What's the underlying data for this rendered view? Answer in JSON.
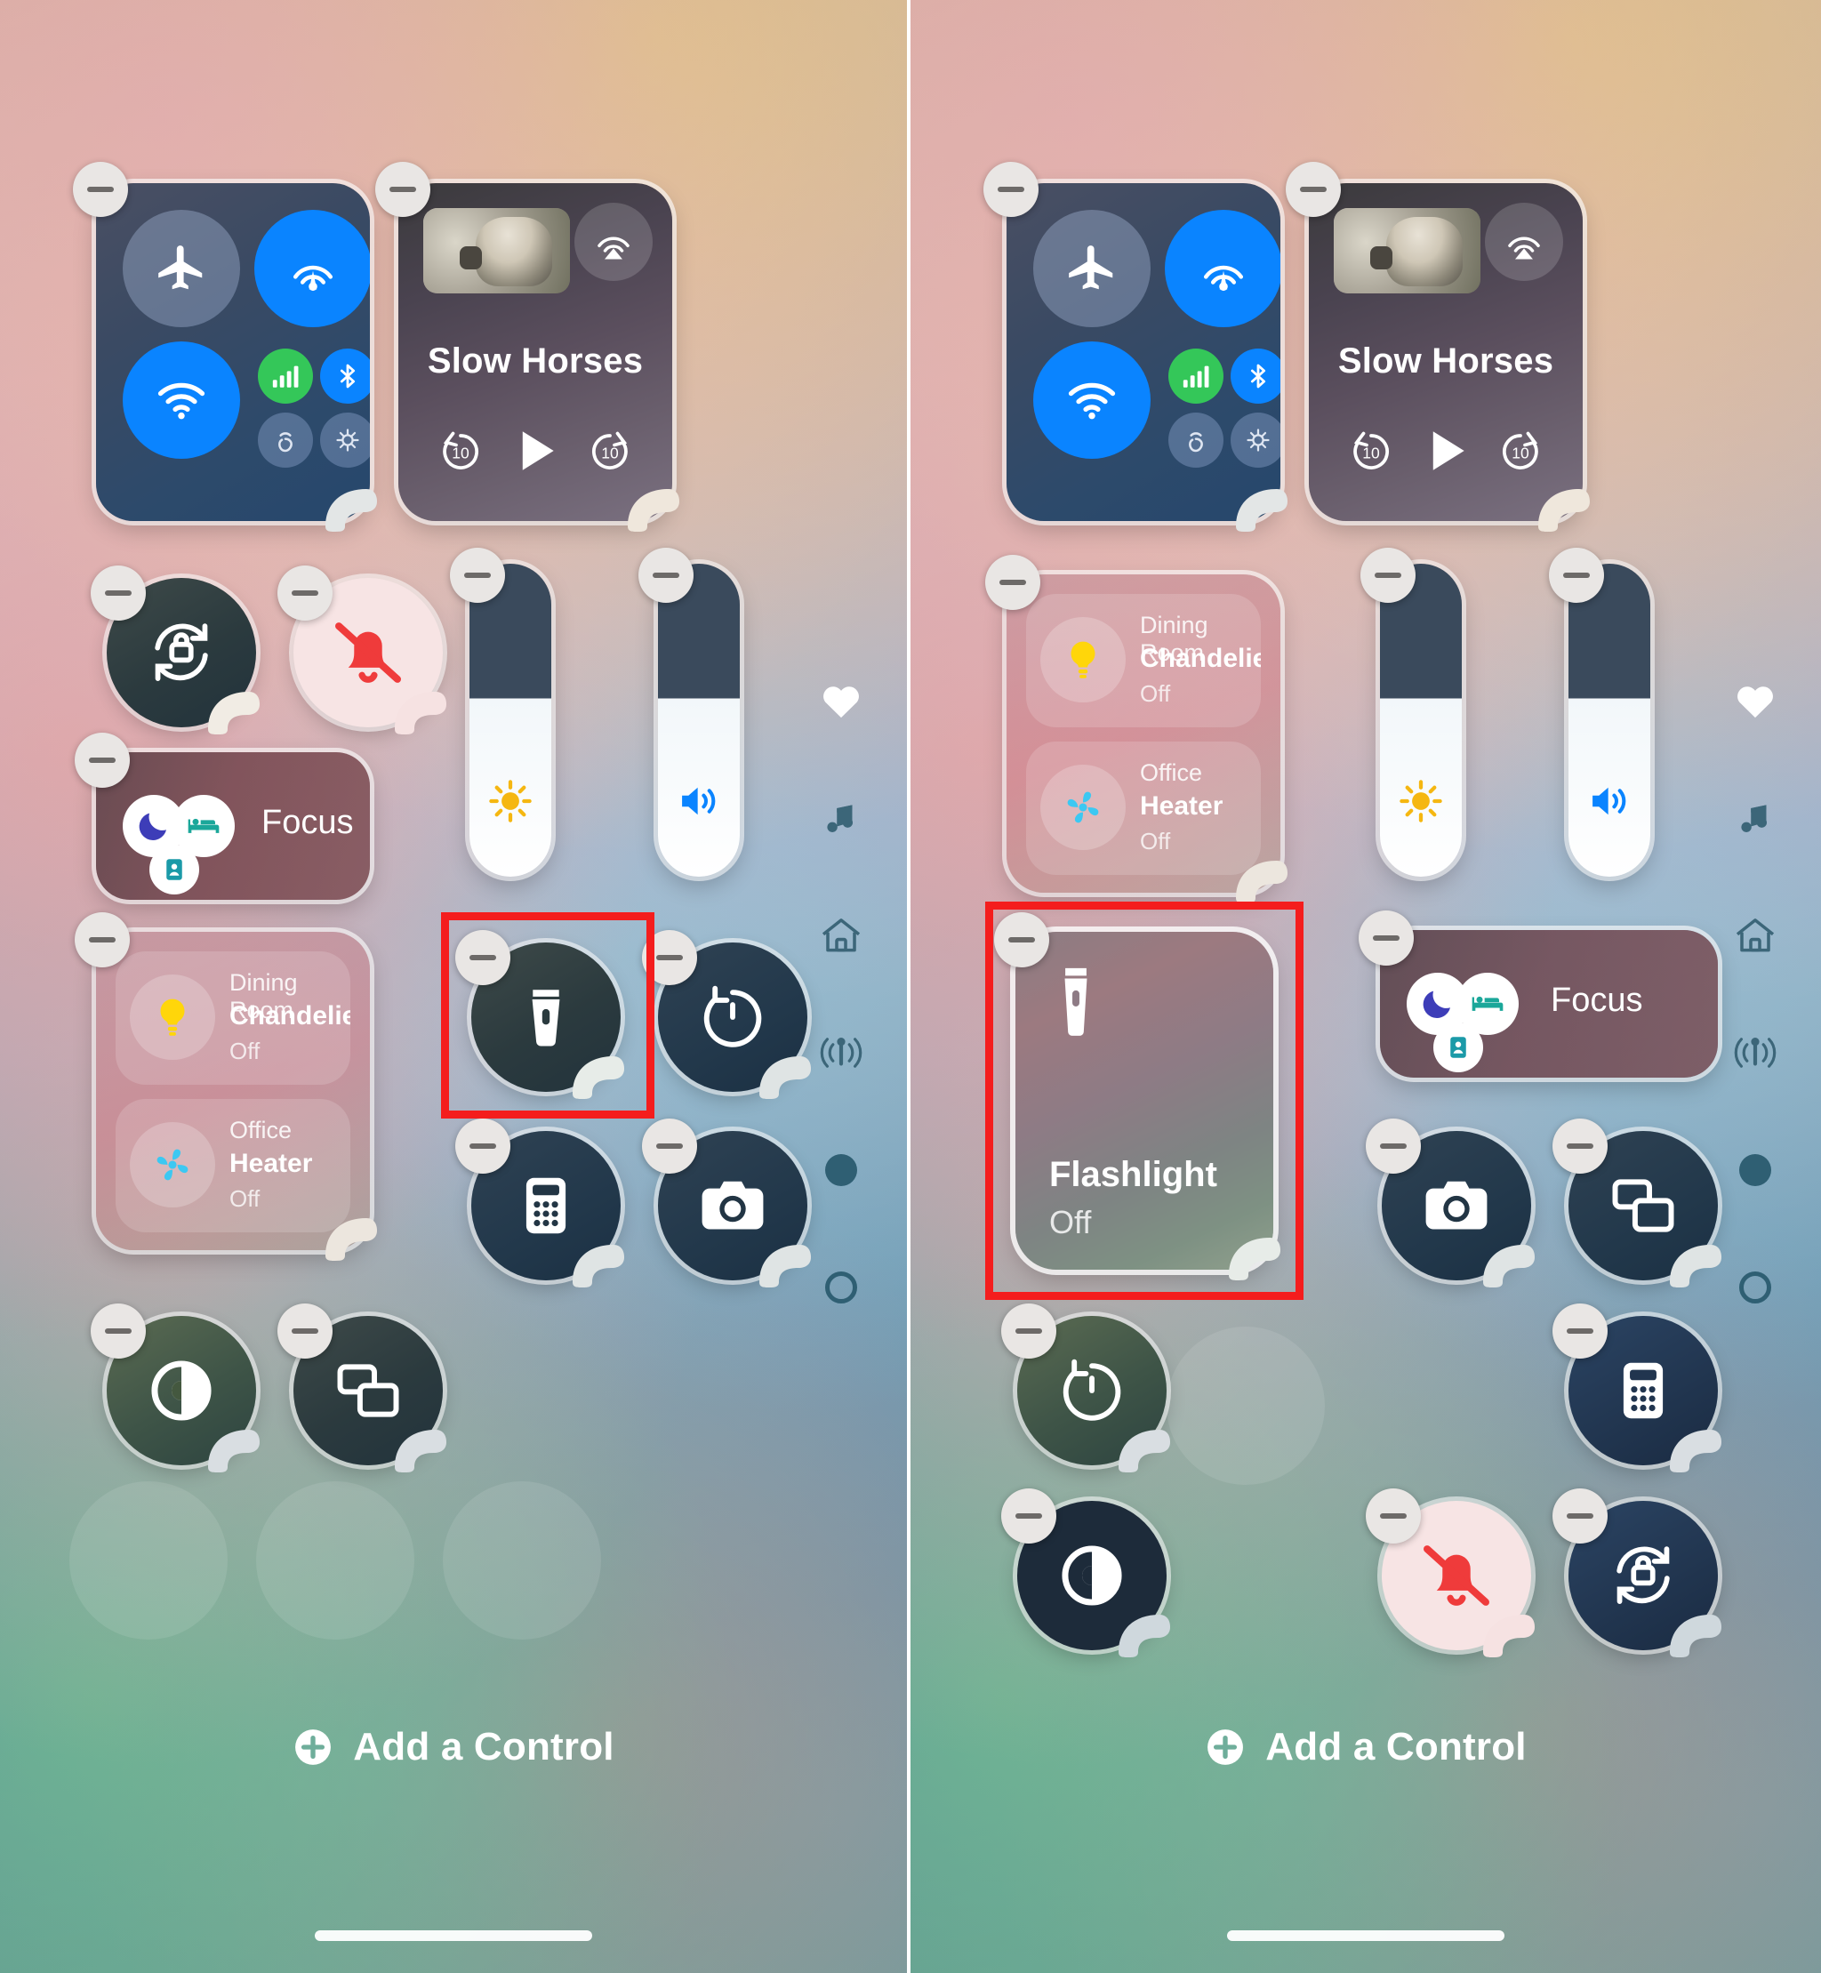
{
  "panels": [
    {
      "id": "before",
      "connectivity": {
        "name": "connectivity-module",
        "buttons": [
          {
            "name": "airplane-mode-toggle",
            "icon": "airplane-icon",
            "state": "off"
          },
          {
            "name": "airdrop-toggle",
            "icon": "airdrop-icon",
            "state": "on"
          },
          {
            "name": "wifi-toggle",
            "icon": "wifi-icon",
            "state": "on"
          },
          {
            "name": "cellular-data-toggle",
            "icon": "cellular-bars-icon",
            "state": "on"
          },
          {
            "name": "bluetooth-toggle",
            "icon": "bluetooth-icon",
            "state": "on"
          },
          {
            "name": "personal-hotspot-toggle",
            "icon": "hotspot-icon",
            "state": "dim"
          },
          {
            "name": "satellite-toggle",
            "icon": "satellite-icon",
            "state": "dim"
          }
        ]
      },
      "media": {
        "name": "now-playing-module",
        "title": "Slow Horses",
        "airplay_label": "airplay-icon",
        "controls": [
          {
            "name": "skip-back-10-button",
            "label": "10"
          },
          {
            "name": "play-button",
            "label": ""
          },
          {
            "name": "skip-forward-10-button",
            "label": "10"
          }
        ]
      },
      "focus": {
        "name": "focus-control",
        "label": "Focus"
      },
      "accessories": [
        {
          "name": "dining-room-chandelier-control",
          "room": "Dining Room",
          "device": "Chandelier",
          "status": "Off",
          "icon": "lightbulb-icon"
        },
        {
          "name": "office-heater-control",
          "room": "Office",
          "device": "Heater",
          "status": "Off",
          "icon": "fan-icon"
        }
      ],
      "sliders": [
        {
          "name": "brightness-slider",
          "icon": "sun-icon"
        },
        {
          "name": "volume-slider",
          "icon": "speaker-wave-icon"
        }
      ],
      "round_controls": [
        {
          "name": "rotation-lock-button",
          "icon": "rotation-lock-icon"
        },
        {
          "name": "silent-mode-button",
          "icon": "bell-slash-icon"
        },
        {
          "name": "flashlight-button",
          "icon": "flashlight-icon"
        },
        {
          "name": "timer-button",
          "icon": "timer-icon"
        },
        {
          "name": "calculator-button",
          "icon": "calculator-icon"
        },
        {
          "name": "camera-button",
          "icon": "camera-icon"
        },
        {
          "name": "dark-mode-button",
          "icon": "dark-mode-icon"
        },
        {
          "name": "screen-mirroring-button",
          "icon": "screen-mirroring-icon"
        }
      ],
      "highlight": {
        "name": "flashlight-highlight-box",
        "target": "flashlight-button",
        "color": "#f41d1d"
      },
      "add_control": {
        "name": "add-a-control-button",
        "label": "Add a Control",
        "icon": "plus-circle-icon"
      }
    },
    {
      "id": "after",
      "connectivity": {
        "name": "connectivity-module",
        "buttons": [
          {
            "name": "airplane-mode-toggle",
            "icon": "airplane-icon",
            "state": "off"
          },
          {
            "name": "airdrop-toggle",
            "icon": "airdrop-icon",
            "state": "on"
          },
          {
            "name": "wifi-toggle",
            "icon": "wifi-icon",
            "state": "on"
          },
          {
            "name": "cellular-data-toggle",
            "icon": "cellular-bars-icon",
            "state": "on"
          },
          {
            "name": "bluetooth-toggle",
            "icon": "bluetooth-icon",
            "state": "on"
          },
          {
            "name": "personal-hotspot-toggle",
            "icon": "hotspot-icon",
            "state": "dim"
          },
          {
            "name": "satellite-toggle",
            "icon": "satellite-icon",
            "state": "dim"
          }
        ]
      },
      "media": {
        "name": "now-playing-module",
        "title": "Slow Horses",
        "airplay_label": "airplay-icon",
        "controls": [
          {
            "name": "skip-back-10-button",
            "label": "10"
          },
          {
            "name": "play-button",
            "label": ""
          },
          {
            "name": "skip-forward-10-button",
            "label": "10"
          }
        ]
      },
      "focus": {
        "name": "focus-control",
        "label": "Focus"
      },
      "accessories": [
        {
          "name": "dining-room-chandelier-control",
          "room": "Dining Room",
          "device": "Chandelier",
          "status": "Off",
          "icon": "lightbulb-icon"
        },
        {
          "name": "office-heater-control",
          "room": "Office",
          "device": "Heater",
          "status": "Off",
          "icon": "fan-icon"
        }
      ],
      "sliders": [
        {
          "name": "brightness-slider",
          "icon": "sun-icon"
        },
        {
          "name": "volume-slider",
          "icon": "speaker-wave-icon"
        }
      ],
      "flashlight_tile": {
        "name": "flashlight-control-expanded",
        "title": "Flashlight",
        "status": "Off",
        "icon": "flashlight-icon"
      },
      "round_controls": [
        {
          "name": "camera-button",
          "icon": "camera-icon"
        },
        {
          "name": "screen-mirroring-button",
          "icon": "screen-mirroring-icon"
        },
        {
          "name": "timer-button",
          "icon": "timer-icon"
        },
        {
          "name": "calculator-button",
          "icon": "calculator-icon"
        },
        {
          "name": "dark-mode-button",
          "icon": "dark-mode-icon"
        },
        {
          "name": "silent-mode-button",
          "icon": "bell-slash-icon"
        },
        {
          "name": "rotation-lock-button",
          "icon": "rotation-lock-icon"
        }
      ],
      "highlight": {
        "name": "flashlight-highlight-box",
        "target": "flashlight-control-expanded",
        "color": "#f41d1d"
      },
      "add_control": {
        "name": "add-a-control-button",
        "label": "Add a Control",
        "icon": "plus-circle-icon"
      }
    }
  ],
  "page_rail": [
    {
      "name": "rail-favorites-icon",
      "icon": "heart-icon",
      "active": true
    },
    {
      "name": "rail-media-icon",
      "icon": "music-note-icon",
      "active": false
    },
    {
      "name": "rail-home-icon",
      "icon": "home-icon",
      "active": false
    },
    {
      "name": "rail-connectivity-icon",
      "icon": "antenna-icon",
      "active": false
    },
    {
      "name": "rail-page-dot-filled",
      "icon": "dot-filled-icon",
      "active": false
    },
    {
      "name": "rail-page-dot-outline",
      "icon": "dot-outline-icon",
      "active": false
    }
  ],
  "accent": {
    "blue": "#0a84ff",
    "green": "#34c759",
    "yellow": "#ffd60a",
    "red": "#f41d1d",
    "white": "#ffffff"
  }
}
